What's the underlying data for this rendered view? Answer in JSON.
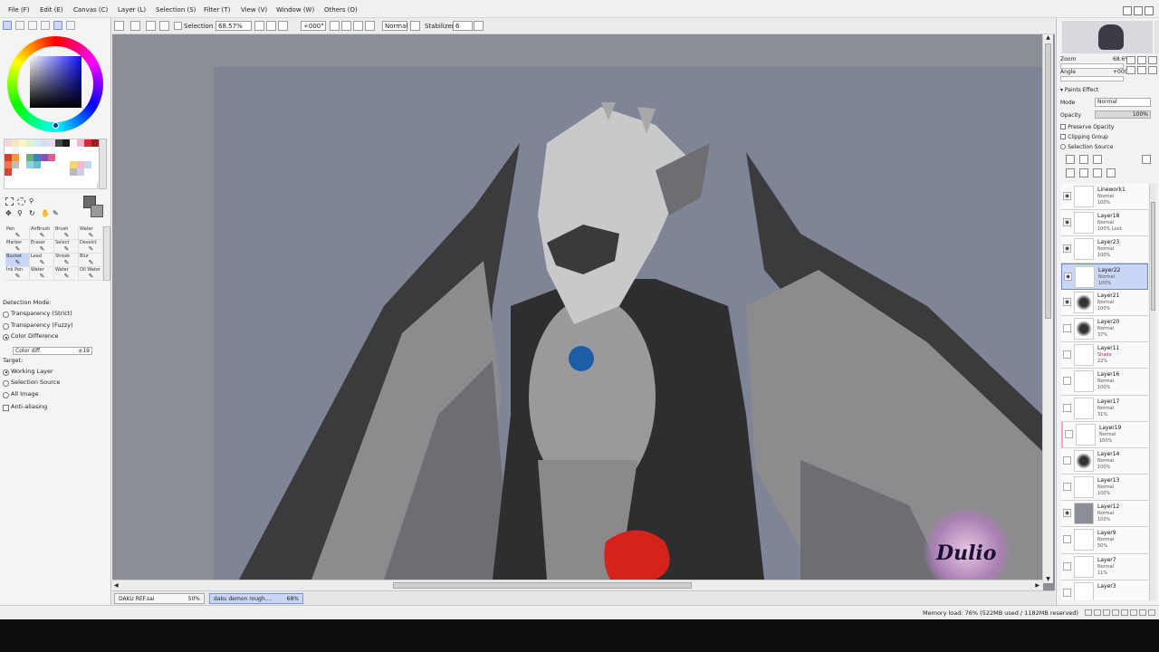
{
  "menu": {
    "items": [
      "File (F)",
      "Edit (E)",
      "Canvas (C)",
      "Layer (L)",
      "Selection (S)",
      "Filter (T)",
      "View (V)",
      "Window (W)",
      "Others (O)"
    ]
  },
  "toolbar": {
    "selection_label": "Selection",
    "zoom_value": "68.57%",
    "angle_value": "+000°",
    "blend_mode": "Normal",
    "stabilizer_label": "Stabilizer",
    "stabilizer_value": "6"
  },
  "tools": {
    "items": [
      "Pen",
      "AirBrush",
      "Brush",
      "Water",
      "Marker",
      "Eraser",
      "Select",
      "Deselct",
      "Bucket",
      "Lead",
      "Streak",
      "Blur",
      "Ink Pen",
      "Water",
      "Water",
      "Oil Water"
    ],
    "selected_index": 8
  },
  "tool_options": {
    "detection_mode_label": "Detection Mode:",
    "detection_modes": [
      "Transparency (Strict)",
      "Transparency (Fuzzy)",
      "Color Difference"
    ],
    "color_diff_label": "Color diff.",
    "color_diff_value": "±19",
    "target_label": "Target:",
    "targets": [
      "Working Layer",
      "Selection Source",
      "All Image"
    ],
    "anti_aliasing_label": "Anti-aliasing"
  },
  "navigator": {
    "zoom_label": "Zoom",
    "zoom_value": "68.6%",
    "angle_label": "Angle",
    "angle_value": "+0000"
  },
  "layer_panel": {
    "paint_effect_label": "Paints Effect",
    "mode_label": "Mode",
    "mode_value": "Normal",
    "opacity_label": "Opacity",
    "opacity_value": "100%",
    "preserve_opacity_label": "Preserve Opacity",
    "clipping_group_label": "Clipping Group",
    "selection_source_label": "Selection Source"
  },
  "layers": [
    {
      "name": "Linework1",
      "mode": "Normal",
      "opacity": "100%"
    },
    {
      "name": "Layer18",
      "mode": "Normal",
      "opacity": "100% Lock"
    },
    {
      "name": "Layer23",
      "mode": "Normal",
      "opacity": "100%"
    },
    {
      "name": "Layer22",
      "mode": "Normal",
      "opacity": "100%"
    },
    {
      "name": "Layer21",
      "mode": "Normal",
      "opacity": "100%"
    },
    {
      "name": "Layer20",
      "mode": "Normal",
      "opacity": "37%"
    },
    {
      "name": "Layer11",
      "mode": "Shade",
      "opacity": "22%"
    },
    {
      "name": "Layer16",
      "mode": "Normal",
      "opacity": "100%"
    },
    {
      "name": "Layer17",
      "mode": "Normal",
      "opacity": "31%"
    },
    {
      "name": "Layer19",
      "mode": "Normal",
      "opacity": "100%"
    },
    {
      "name": "Layer14",
      "mode": "Normal",
      "opacity": "100%"
    },
    {
      "name": "Layer13",
      "mode": "Normal",
      "opacity": "100%"
    },
    {
      "name": "Layer12",
      "mode": "Normal",
      "opacity": "100%"
    },
    {
      "name": "Layer9",
      "mode": "Normal",
      "opacity": "50%"
    },
    {
      "name": "Layer7",
      "mode": "Normal",
      "opacity": "11%"
    },
    {
      "name": "Layer3",
      "mode": "",
      "opacity": ""
    }
  ],
  "documents": [
    {
      "name": "DAKU REF.sai",
      "zoom": "50%"
    },
    {
      "name": "daku demon rough....",
      "zoom": "68%"
    }
  ],
  "status": {
    "memory": "Memory load: 76% (522MB used / 1182MB reserved)"
  },
  "artwork": {
    "signature": "Dulio"
  },
  "colors": {
    "canvas_bg": "#8b8e97",
    "paper": "#7f8597",
    "accent_blue": "#1c5fa8",
    "accent_red": "#d3231b",
    "selected_layer": "#c9d6f5"
  }
}
